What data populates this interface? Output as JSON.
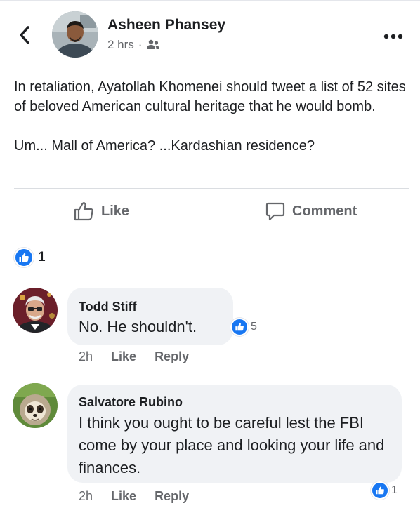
{
  "post": {
    "author": "Asheen Phansey",
    "time": "2 hrs",
    "separator": "·",
    "audience_icon": "friends-icon",
    "paragraph1": "In retaliation, Ayatollah Khomenei should tweet a list of 52 sites of beloved American cultural heritage that he would bomb.",
    "paragraph2": "Um... Mall of America? ...Kardashian residence?",
    "reaction_count": "1"
  },
  "actions": {
    "like_label": "Like",
    "comment_label": "Comment"
  },
  "comments": [
    {
      "name": "Todd Stiff",
      "text": "No. He shouldn't.",
      "time": "2h",
      "like_label": "Like",
      "reply_label": "Reply",
      "reaction_count": "5"
    },
    {
      "name": "Salvatore Rubino",
      "text": "I think you ought to be careful lest the FBI come by your place and looking your life and finances.",
      "time": "2h",
      "like_label": "Like",
      "reply_label": "Reply",
      "reaction_count": "1"
    }
  ],
  "colors": {
    "accent": "#1877f2",
    "secondary_text": "#65676b",
    "bubble": "#f0f2f5"
  }
}
